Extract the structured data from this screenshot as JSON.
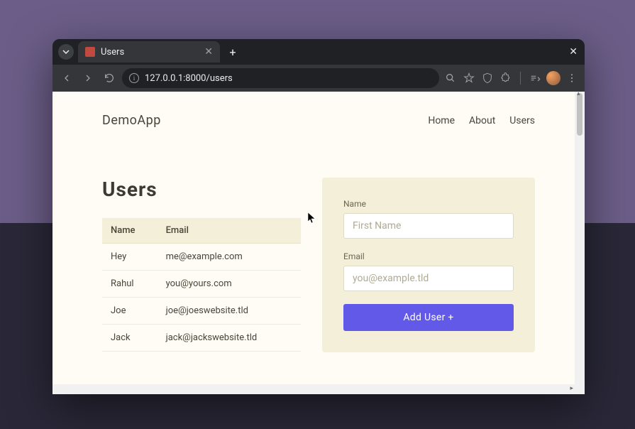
{
  "browser": {
    "tab_title": "Users",
    "url": "127.0.0.1:8000/users"
  },
  "page": {
    "brand": "DemoApp",
    "nav": [
      "Home",
      "About",
      "Users"
    ],
    "title": "Users",
    "table": {
      "headers": [
        "Name",
        "Email"
      ],
      "rows": [
        {
          "name": "Hey",
          "email": "me@example.com"
        },
        {
          "name": "Rahul",
          "email": "you@yours.com"
        },
        {
          "name": "Joe",
          "email": "joe@joeswebsite.tld"
        },
        {
          "name": "Jack",
          "email": "jack@jackswebsite.tld"
        }
      ]
    },
    "form": {
      "name_label": "Name",
      "name_placeholder": "First Name",
      "email_label": "Email",
      "email_placeholder": "you@example.tld",
      "submit_label": "Add User +"
    }
  }
}
